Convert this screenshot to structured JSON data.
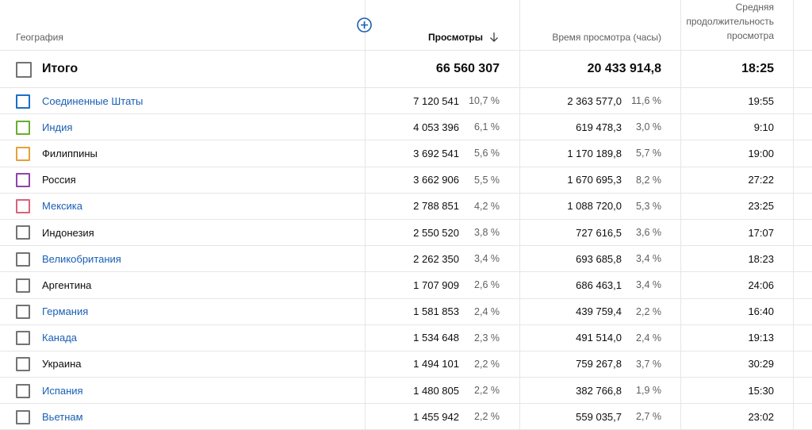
{
  "columns": {
    "geography": "География",
    "views": "Просмотры",
    "watch_time": "Время просмотра (часы)",
    "avg_duration_line1": "Средняя",
    "avg_duration_line2": "продолжительность",
    "avg_duration_line3": "просмотра"
  },
  "sort": {
    "column": "views",
    "direction": "desc",
    "icon": "arrow-down-icon"
  },
  "add_column_icon": "plus-circle-icon",
  "accent_color": "#1a5fb4",
  "total": {
    "label": "Итого",
    "views": "66 560 307",
    "watch_time": "20 433 914,8",
    "avg_duration": "18:25"
  },
  "rows": [
    {
      "country": "Соединенные Штаты",
      "views": "7 120 541",
      "views_pct": "10,7 %",
      "watch_time": "2 363 577,0",
      "watch_pct": "11,6 %",
      "avg_duration": "19:55",
      "link": true,
      "checkbox_color": "#1a6fc9"
    },
    {
      "country": "Индия",
      "views": "4 053 396",
      "views_pct": "6,1 %",
      "watch_time": "619 478,3",
      "watch_pct": "3,0 %",
      "avg_duration": "9:10",
      "link": true,
      "checkbox_color": "#6aad2d"
    },
    {
      "country": "Филиппины",
      "views": "3 692 541",
      "views_pct": "5,6 %",
      "watch_time": "1 170 189,8",
      "watch_pct": "5,7 %",
      "avg_duration": "19:00",
      "link": false,
      "checkbox_color": "#e3a23b"
    },
    {
      "country": "Россия",
      "views": "3 662 906",
      "views_pct": "5,5 %",
      "watch_time": "1 670 695,3",
      "watch_pct": "8,2 %",
      "avg_duration": "27:22",
      "link": false,
      "checkbox_color": "#8e44ad"
    },
    {
      "country": "Мексика",
      "views": "2 788 851",
      "views_pct": "4,2 %",
      "watch_time": "1 088 720,0",
      "watch_pct": "5,3 %",
      "avg_duration": "23:25",
      "link": true,
      "checkbox_color": "#d9637a"
    },
    {
      "country": "Индонезия",
      "views": "2 550 520",
      "views_pct": "3,8 %",
      "watch_time": "727 616,5",
      "watch_pct": "3,6 %",
      "avg_duration": "17:07",
      "link": false,
      "checkbox_color": "#737373"
    },
    {
      "country": "Великобритания",
      "views": "2 262 350",
      "views_pct": "3,4 %",
      "watch_time": "693 685,8",
      "watch_pct": "3,4 %",
      "avg_duration": "18:23",
      "link": true,
      "checkbox_color": "#737373"
    },
    {
      "country": "Аргентина",
      "views": "1 707 909",
      "views_pct": "2,6 %",
      "watch_time": "686 463,1",
      "watch_pct": "3,4 %",
      "avg_duration": "24:06",
      "link": false,
      "checkbox_color": "#737373"
    },
    {
      "country": "Германия",
      "views": "1 581 853",
      "views_pct": "2,4 %",
      "watch_time": "439 759,4",
      "watch_pct": "2,2 %",
      "avg_duration": "16:40",
      "link": true,
      "checkbox_color": "#737373"
    },
    {
      "country": "Канада",
      "views": "1 534 648",
      "views_pct": "2,3 %",
      "watch_time": "491 514,0",
      "watch_pct": "2,4 %",
      "avg_duration": "19:13",
      "link": true,
      "checkbox_color": "#737373"
    },
    {
      "country": "Украина",
      "views": "1 494 101",
      "views_pct": "2,2 %",
      "watch_time": "759 267,8",
      "watch_pct": "3,7 %",
      "avg_duration": "30:29",
      "link": false,
      "checkbox_color": "#737373"
    },
    {
      "country": "Испания",
      "views": "1 480 805",
      "views_pct": "2,2 %",
      "watch_time": "382 766,8",
      "watch_pct": "1,9 %",
      "avg_duration": "15:30",
      "link": true,
      "checkbox_color": "#737373"
    },
    {
      "country": "Вьетнам",
      "views": "1 455 942",
      "views_pct": "2,2 %",
      "watch_time": "559 035,7",
      "watch_pct": "2,7 %",
      "avg_duration": "23:02",
      "link": true,
      "checkbox_color": "#737373"
    }
  ]
}
